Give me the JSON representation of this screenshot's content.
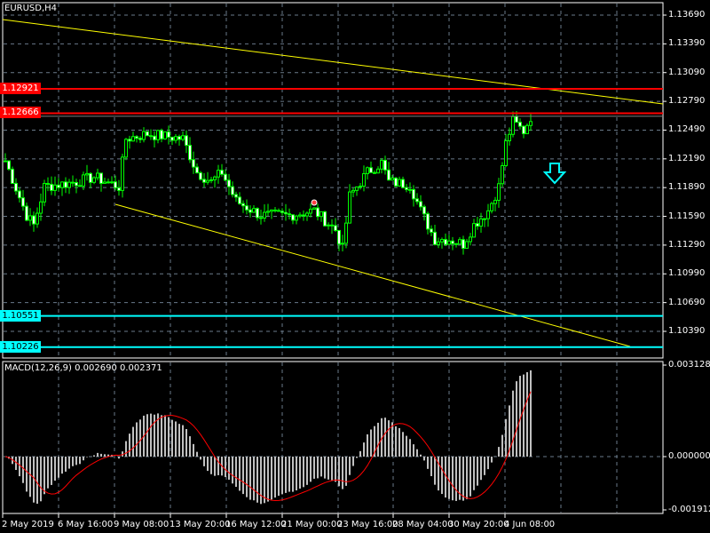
{
  "chart": {
    "title": "EURUSD,H4",
    "symbol": "EURUSD",
    "timeframe": "H4",
    "price_range": [
      1.1005,
      1.1375
    ],
    "price_ticks": [
      "1.13690",
      "1.13390",
      "1.13090",
      "1.12790",
      "1.12490",
      "1.12190",
      "1.11890",
      "1.11590",
      "1.11290",
      "1.10990",
      "1.10690",
      "1.10390"
    ],
    "time_ticks": [
      "2 May 2019",
      "6 May 16:00",
      "9 May 08:00",
      "13 May 20:00",
      "16 May 12:00",
      "21 May 00:00",
      "23 May 16:00",
      "28 May 04:00",
      "30 May 20:00",
      "4 Jun 08:00"
    ],
    "bar_count": 149,
    "price_path": [
      [
        0,
        1.1217
      ],
      [
        6,
        1.116
      ],
      [
        8,
        1.115
      ],
      [
        11,
        1.119
      ],
      [
        20,
        1.1195
      ],
      [
        25,
        1.12
      ],
      [
        32,
        1.119
      ],
      [
        34,
        1.124
      ],
      [
        40,
        1.1245
      ],
      [
        50,
        1.124
      ],
      [
        54,
        1.1205
      ],
      [
        58,
        1.1195
      ],
      [
        61,
        1.1205
      ],
      [
        65,
        1.1175
      ],
      [
        72,
        1.116
      ],
      [
        80,
        1.116
      ],
      [
        87,
        1.1165
      ],
      [
        93,
        1.1145
      ],
      [
        95,
        1.1125
      ],
      [
        97,
        1.118
      ],
      [
        102,
        1.1205
      ],
      [
        106,
        1.1215
      ],
      [
        108,
        1.1195
      ],
      [
        114,
        1.1192
      ],
      [
        117,
        1.1165
      ],
      [
        121,
        1.1135
      ],
      [
        125,
        1.1135
      ],
      [
        129,
        1.113
      ],
      [
        132,
        1.115
      ],
      [
        136,
        1.1165
      ],
      [
        139,
        1.119
      ],
      [
        141,
        1.1235
      ],
      [
        143,
        1.1258
      ],
      [
        146,
        1.1248
      ],
      [
        148,
        1.1263
      ]
    ],
    "horizontal_lines": [
      {
        "price": 1.12921,
        "label": "1.12921",
        "color": "#ff0000"
      },
      {
        "price": 1.12666,
        "label": "1.12666",
        "color": "#ff0000"
      },
      {
        "price": 1.10551,
        "label": "1.10551",
        "color": "#00ffff"
      },
      {
        "price": 1.10226,
        "label": "1.10226",
        "color": "#00ffff"
      }
    ],
    "bid_price": 1.12634,
    "colors": {
      "candle": "#00ff00",
      "trendline": "#ffff00",
      "grid": "#6a7a8a",
      "arrow": "#00ffff"
    }
  },
  "macd": {
    "label": "MACD(12,26,9) 0.002690 0.002371",
    "params": "12,26,9",
    "value": "0.002690",
    "signal": "0.002371",
    "axis_ticks": [
      "0.003128",
      "0.000000",
      "-0.001912"
    ],
    "range": [
      -0.001912,
      0.003128
    ],
    "colors": {
      "histogram": "#c0c0c0",
      "signal": "#ff0000"
    }
  }
}
